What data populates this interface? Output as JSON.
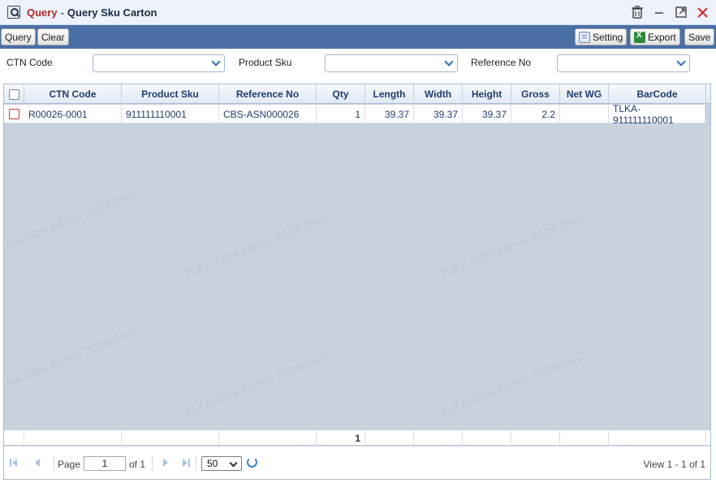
{
  "window": {
    "title_main": "Query",
    "title_sep": "-",
    "title_sub": "Query Sku Carton",
    "icons": [
      "search-icon",
      "trash-icon",
      "minimize-icon",
      "maximize-icon",
      "close-icon"
    ]
  },
  "toolbar": {
    "query_label": "Query",
    "clear_label": "Clear",
    "setting_label": "Setting",
    "export_label": "Export",
    "save_label": "Save"
  },
  "filters": {
    "ctn_code_label": "CTN Code",
    "product_sku_label": "Product Sku",
    "reference_no_label": "Reference No",
    "ctn_code_value": "",
    "product_sku_value": "",
    "reference_no_value": ""
  },
  "grid": {
    "columns": [
      "CTN Code",
      "Product Sku",
      "Reference No",
      "Qty",
      "Length",
      "Width",
      "Height",
      "Gross",
      "Net WG",
      "BarCode"
    ],
    "rows": [
      {
        "ctn_code": "R00026-0001",
        "product_sku": "911111110001",
        "reference_no": "CBS-ASN000026",
        "qty": "1",
        "length": "39.37",
        "width": "39.37",
        "height": "39.37",
        "gross": "2.2",
        "net_wg": "",
        "barcode": "TLKA-911111110001"
      }
    ],
    "sum_qty": "1"
  },
  "pager": {
    "page_label": "Page",
    "page_value": "1",
    "of_label": "of 1",
    "page_size": "50",
    "view_text": "View 1 - 1 of 1"
  },
  "watermark": "TLKA CBS Admin 2024-05-27",
  "colors": {
    "toolbar_bg": "#4a6fa5",
    "title_accent": "#b02a2a",
    "grid_bg": "#c9d3de",
    "header_text": "#1f3d6e"
  }
}
